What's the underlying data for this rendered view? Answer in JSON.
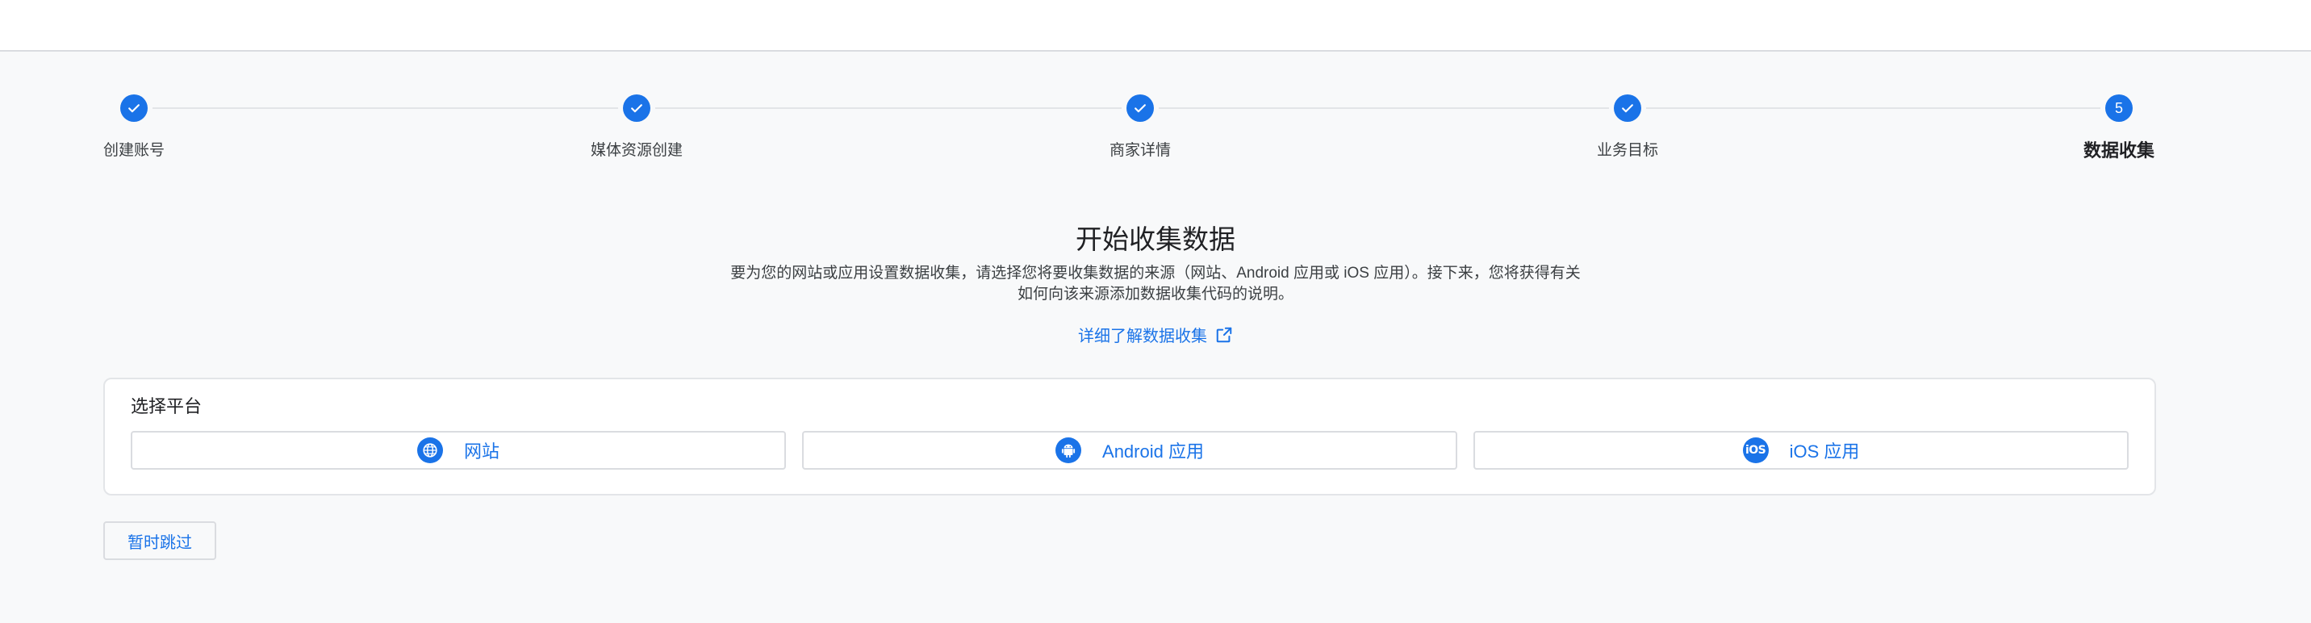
{
  "stepper": {
    "steps": [
      {
        "label": "创建账号",
        "state": "done"
      },
      {
        "label": "媒体资源创建",
        "state": "done"
      },
      {
        "label": "商家详情",
        "state": "done"
      },
      {
        "label": "业务目标",
        "state": "done"
      },
      {
        "label": "数据收集",
        "state": "current",
        "number": "5"
      }
    ]
  },
  "main": {
    "title": "开始收集数据",
    "description_line1": "要为您的网站或应用设置数据收集，请选择您将要收集数据的来源（网站、Android 应用或 iOS 应用）。接下来，您将获得有关",
    "description_line2": "如何向该来源添加数据收集代码的说明。",
    "learn_more": "详细了解数据收集"
  },
  "platform_panel": {
    "title": "选择平台",
    "buttons": [
      {
        "label": "网站",
        "icon": "globe-icon"
      },
      {
        "label": "Android 应用",
        "icon": "android-icon"
      },
      {
        "label": "iOS 应用",
        "icon": "ios-icon",
        "icon_text": "iOS"
      }
    ]
  },
  "skip": {
    "label": "暂时跳过"
  },
  "colors": {
    "accent": "#1a73e8",
    "background": "#f8f9fa",
    "border": "#dadce0"
  }
}
